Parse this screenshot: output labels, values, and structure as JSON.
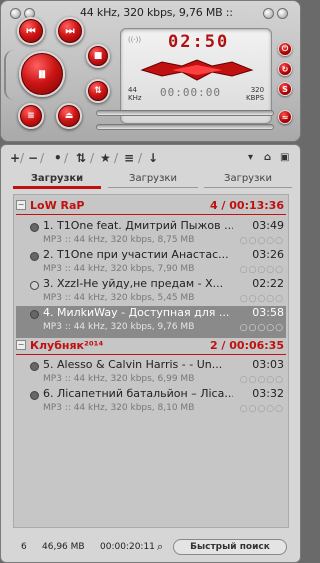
{
  "player": {
    "ticker": "44 kHz, 320 kbps, 9,76 MB ::",
    "time": "02:50",
    "position": "00:00:00",
    "left_freq": "44\nKHz",
    "right_kbps": "320\nKBPS",
    "logo_alt": "AIMP",
    "btn_prev": "⏮",
    "btn_pause": "⏸",
    "btn_next": "⏭",
    "btn_stop": "■",
    "btn_eject": "⏏",
    "btn_shuffle": "⇅"
  },
  "toolbar": [
    "+",
    "/",
    "−",
    "/",
    "•",
    "/",
    "⇅",
    "/",
    "★",
    "/",
    "≡",
    "/",
    "↓"
  ],
  "tabs": [
    "Загрузки",
    "Загрузки",
    "Загрузки"
  ],
  "groups": [
    {
      "name": "LoW RaP",
      "info": "4 / 00:13:36"
    },
    {
      "name": "Клубняк²⁰¹⁴",
      "info": "2 / 00:06:35"
    }
  ],
  "tracks": [
    {
      "title": "1. T1One feat. Дмитрий Пыжов ...",
      "duration": "03:49",
      "meta": "MP3 :: 44 kHz, 320 kbps, 8,75 MB",
      "playing": true
    },
    {
      "title": "2. T1One при участии Анастас...",
      "duration": "03:26",
      "meta": "MP3 :: 44 kHz, 320 kbps, 7,90 MB",
      "playing": true
    },
    {
      "title": "3. XzzI-Не уйду,не предам - X...",
      "duration": "02:22",
      "meta": "MP3 :: 44 kHz, 320 kbps, 5,45 MB",
      "playing": false
    },
    {
      "title": "4. МилkиWay - Доступная для ...",
      "duration": "03:58",
      "meta": "MP3 :: 44 kHz, 320 kbps, 9,76 MB",
      "playing": true,
      "selected": true
    },
    {
      "title": "5. Alesso & Calvin Harris - - Un...",
      "duration": "03:03",
      "meta": "MP3 :: 44 kHz, 320 kbps, 6,99 MB",
      "playing": true
    },
    {
      "title": "6. Лісапетний батальйон – Ліса...",
      "duration": "03:32",
      "meta": "MP3 :: 44 kHz, 320 kbps, 8,10 MB",
      "playing": true
    }
  ],
  "circles": "○○○○○",
  "status": {
    "count": "6",
    "size": "46,96 MB",
    "duration": "00:00:20:11",
    "search": "Быстрый поиск"
  },
  "colors": {
    "accent": "#c01010",
    "panel": "#d6d6d6"
  }
}
